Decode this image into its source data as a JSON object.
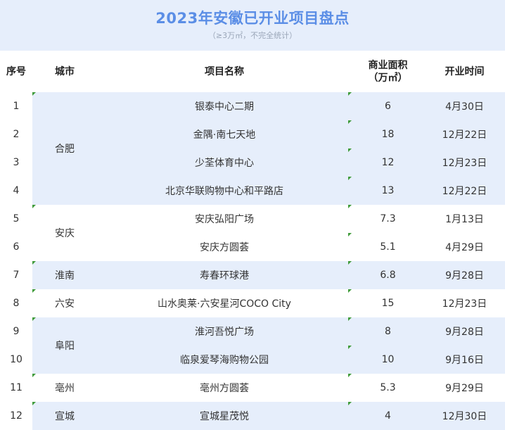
{
  "title": "2023年安徽已开业项目盘点",
  "subtitle": "（≥3万㎡，不完全统计）",
  "columns": [
    "序号",
    "城市",
    "项目名称",
    "商业面积",
    "（万㎡）",
    "开业时间"
  ],
  "rows": [
    {
      "no": "1",
      "project": "银泰中心二期",
      "area": "6",
      "date": "4月30日"
    },
    {
      "no": "2",
      "project": "金隅·南七天地",
      "area": "18",
      "date": "12月22日"
    },
    {
      "no": "3",
      "project": "少荃体育中心",
      "area": "12",
      "date": "12月23日"
    },
    {
      "no": "4",
      "project": "北京华联购物中心和平路店",
      "area": "13",
      "date": "12月22日"
    },
    {
      "no": "5",
      "project": "安庆弘阳广场",
      "area": "7.3",
      "date": "1月13日"
    },
    {
      "no": "6",
      "project": "安庆方圆荟",
      "area": "5.1",
      "date": "4月29日"
    },
    {
      "no": "7",
      "project": "寿春环球港",
      "area": "6.8",
      "date": "9月28日"
    },
    {
      "no": "8",
      "project": "山水奥莱·六安星河COCO City",
      "area": "15",
      "date": "12月23日"
    },
    {
      "no": "9",
      "project": "淮河吾悦广场",
      "area": "8",
      "date": "9月28日"
    },
    {
      "no": "10",
      "project": "临泉爱琴海购物公园",
      "area": "10",
      "date": "9月16日"
    },
    {
      "no": "11",
      "project": "亳州方圆荟",
      "area": "5.3",
      "date": "9月29日"
    },
    {
      "no": "12",
      "project": "宣城星茂悦",
      "area": "4",
      "date": "12月30日"
    }
  ],
  "cities": [
    "合肥",
    "安庆",
    "淮南",
    "六安",
    "阜阳",
    "亳州",
    "宣城"
  ],
  "colors": {
    "title": "#5b8ee6",
    "band": "#e6eefb",
    "marker": "#3f9b3a"
  }
}
